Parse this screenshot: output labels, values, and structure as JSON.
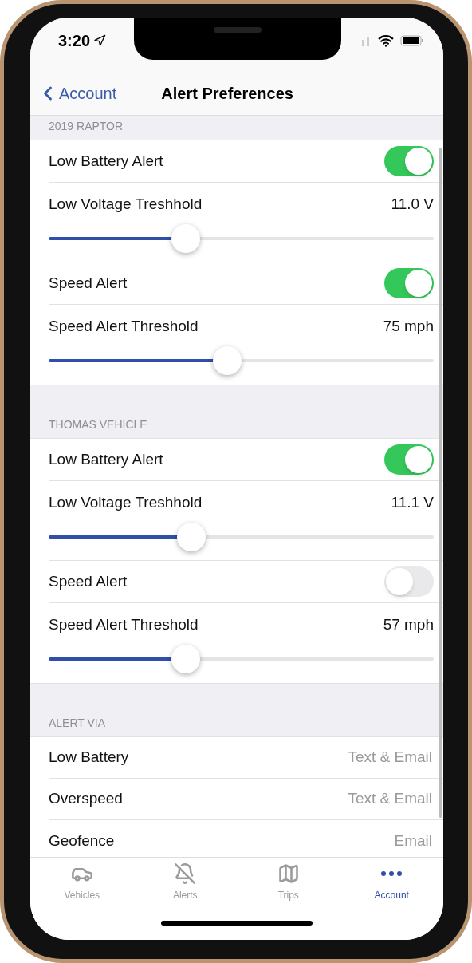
{
  "status_bar": {
    "time": "3:20"
  },
  "nav": {
    "back": "Account",
    "title": "Alert Preferences"
  },
  "sections": [
    {
      "title": "2019 RAPTOR",
      "items": [
        {
          "kind": "toggle",
          "label": "Low Battery Alert",
          "on": true
        },
        {
          "kind": "slider",
          "label": "Low Voltage Treshhold",
          "reading": "11.0 V",
          "level": 0.345
        },
        {
          "kind": "toggle",
          "label": "Speed Alert",
          "on": true
        },
        {
          "kind": "slider",
          "label": "Speed Alert Threshold",
          "reading": "75 mph",
          "level": 0.46
        }
      ]
    },
    {
      "title": "THOMAS VEHICLE",
      "items": [
        {
          "kind": "toggle",
          "label": "Low Battery Alert",
          "on": true
        },
        {
          "kind": "slider",
          "label": "Low Voltage Treshhold",
          "reading": "11.1 V",
          "level": 0.36
        },
        {
          "kind": "toggle",
          "label": "Speed Alert",
          "on": false
        },
        {
          "kind": "slider",
          "label": "Speed Alert Threshold",
          "reading": "57 mph",
          "level": 0.345
        }
      ]
    },
    {
      "title": "ALERT VIA",
      "items": [
        {
          "kind": "value",
          "label": "Low Battery",
          "value": "Text & Email"
        },
        {
          "kind": "value",
          "label": "Overspeed",
          "value": "Text & Email"
        },
        {
          "kind": "value",
          "label": "Geofence",
          "value": "Email"
        }
      ]
    }
  ],
  "tabs": [
    {
      "label": "Vehicles",
      "selected": false
    },
    {
      "label": "Alerts",
      "selected": false
    },
    {
      "label": "Trips",
      "selected": false
    },
    {
      "label": "Account",
      "selected": true
    }
  ]
}
